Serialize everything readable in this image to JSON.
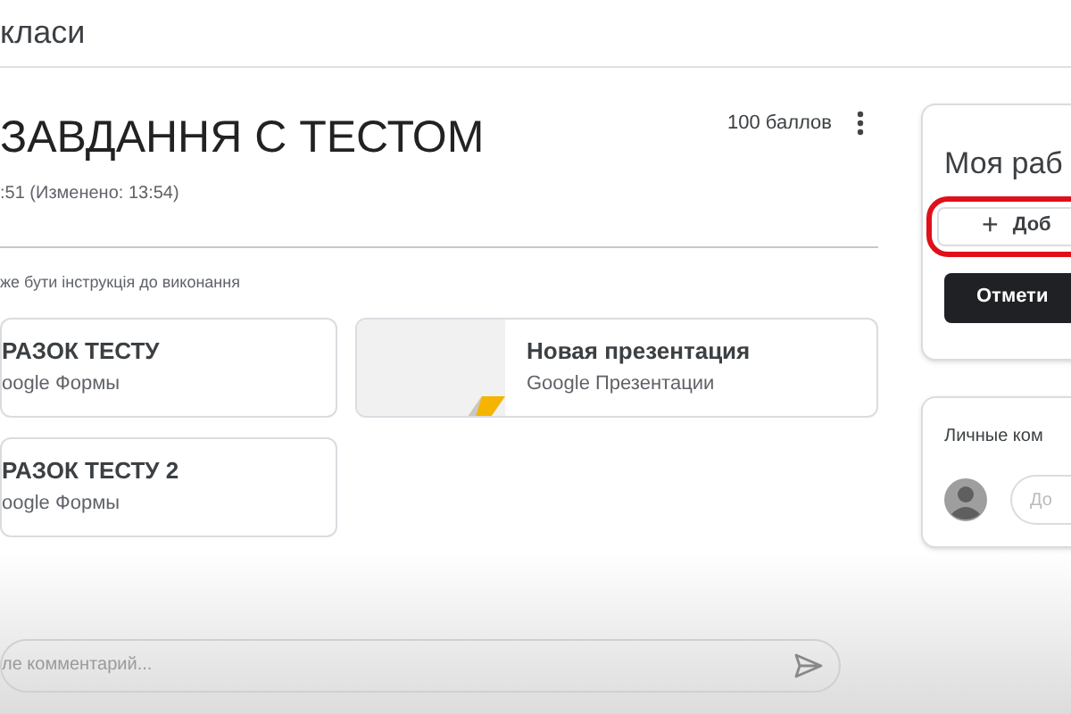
{
  "header": {
    "title": "класи"
  },
  "assignment": {
    "title": "ЗАВДАННЯ С ТЕСТОМ",
    "points": "100 баллов",
    "meta": ":51 (Изменено: 13:54)",
    "instructions": "же бути інструкція до виконання"
  },
  "attachments": [
    {
      "kind": "form",
      "title": "РАЗОК ТЕСТУ",
      "type": "oogle Формы"
    },
    {
      "kind": "slides",
      "title": "Новая презентация",
      "type": "Google Презентации"
    },
    {
      "kind": "form",
      "title": "РАЗОК ТЕСТУ 2",
      "type": "oogle Формы"
    }
  ],
  "comment_field": {
    "placeholder": "ле комментарий..."
  },
  "my_work": {
    "title": "Моя раб",
    "add_button": {
      "icon": "+",
      "label": "Доб",
      "highlighted": true
    },
    "mark_button": "Отмети"
  },
  "private_comments": {
    "title": "Личные ком",
    "placeholder": "До"
  }
}
